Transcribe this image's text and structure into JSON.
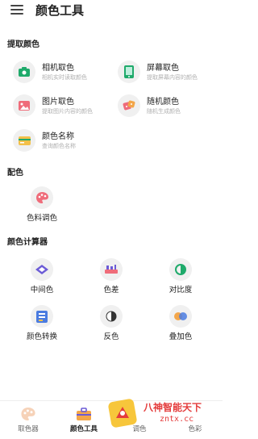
{
  "app": {
    "title": "颜色工具"
  },
  "sections": {
    "extract": "提取颜色",
    "match": "配色",
    "calc": "颜色计算器"
  },
  "extract_tools": [
    {
      "title": "相机取色",
      "desc": "相机实时读取颜色"
    },
    {
      "title": "屏幕取色",
      "desc": "提取屏幕内容的颜色"
    },
    {
      "title": "图片取色",
      "desc": "提取图片内容的颜色"
    },
    {
      "title": "随机颜色",
      "desc": "随机生成颜色"
    },
    {
      "title": "颜色名称",
      "desc": "查询颜色名称"
    }
  ],
  "match_tools": [
    {
      "title": "色料调色"
    }
  ],
  "calc_tools": [
    {
      "title": "中间色"
    },
    {
      "title": "色差"
    },
    {
      "title": "对比度"
    },
    {
      "title": "颜色转换"
    },
    {
      "title": "反色"
    },
    {
      "title": "叠加色"
    }
  ],
  "tabs": [
    {
      "label": "取色器"
    },
    {
      "label": "颜色工具"
    },
    {
      "label": "调色"
    },
    {
      "label": "色彩"
    }
  ],
  "watermark": {
    "line1": "八神智能天下",
    "line2": "zntx.cc"
  },
  "colors": {
    "accent": "#1faa6b",
    "pink": "#ef6c7a",
    "purple": "#6b5bd6",
    "orange": "#f3a64a"
  }
}
